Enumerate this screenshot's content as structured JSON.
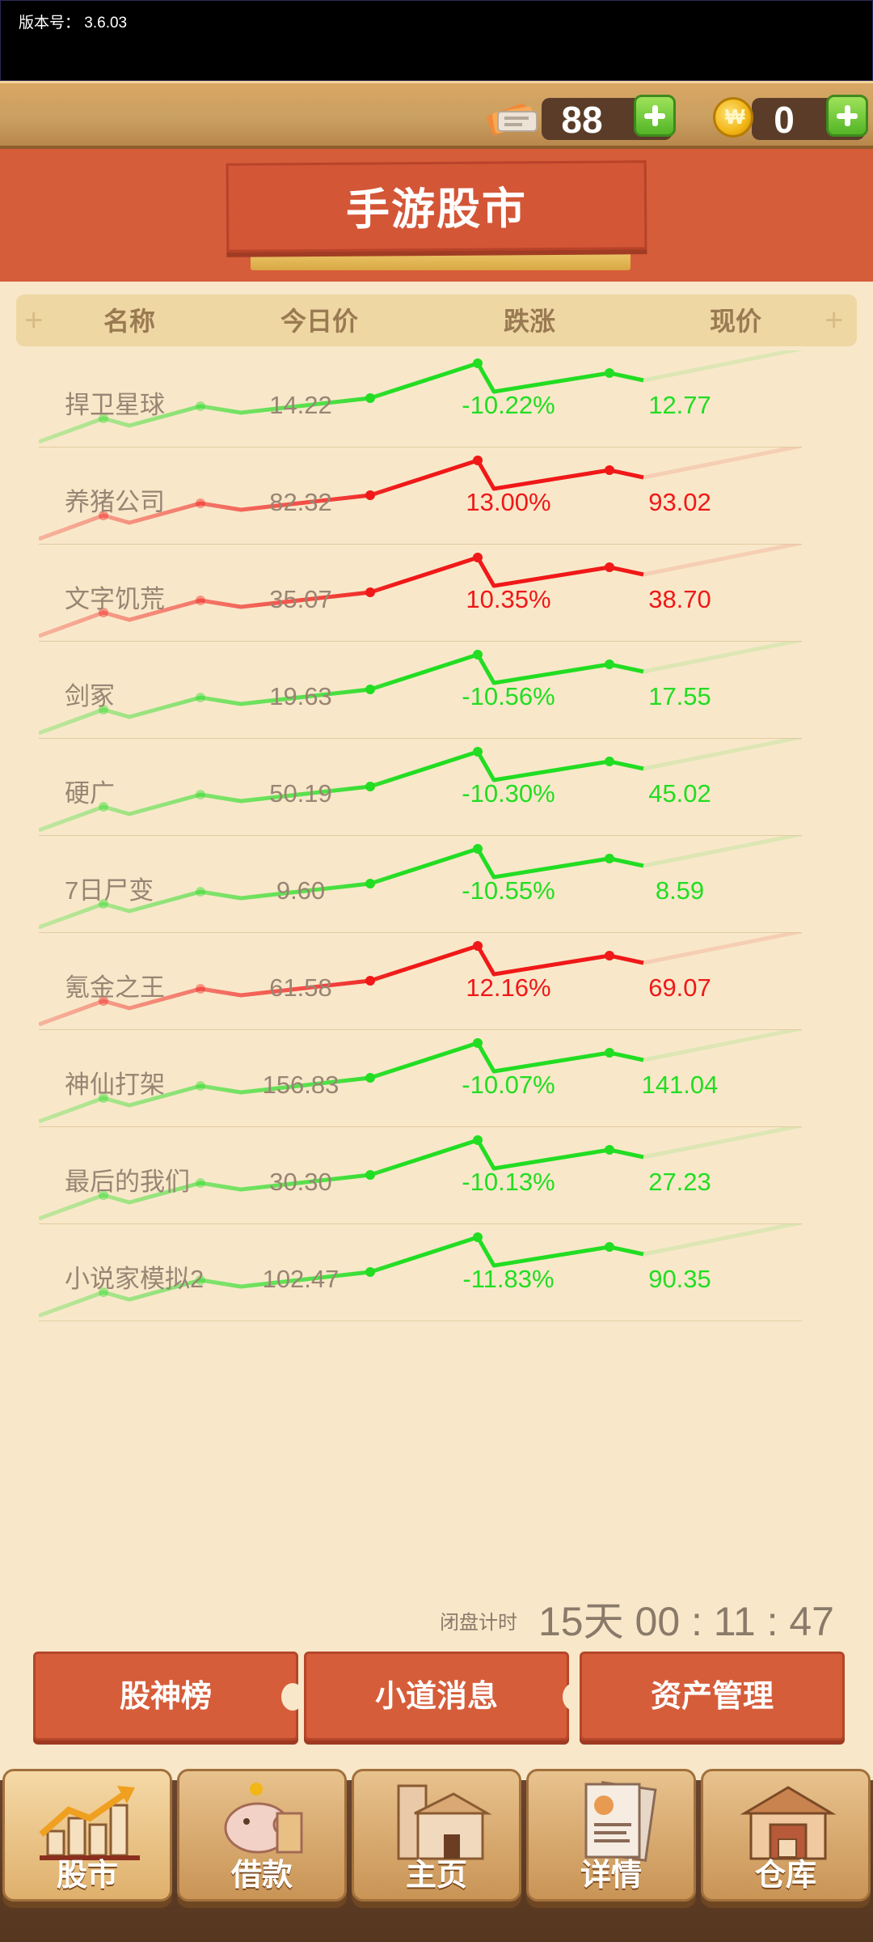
{
  "version_text": "版本号：  3.6.03",
  "resources": {
    "tickets": "88",
    "coins": "0",
    "coin_symbol": "₩"
  },
  "title": "手游股市",
  "columns": {
    "name": "名称",
    "today": "今日价",
    "change": "跌涨",
    "current": "现价"
  },
  "stocks": [
    {
      "name": "捍卫星球",
      "today": "14.22",
      "change": "-10.22%",
      "current": "12.77",
      "trend": "down"
    },
    {
      "name": "养猪公司",
      "today": "82.32",
      "change": "13.00%",
      "current": "93.02",
      "trend": "up"
    },
    {
      "name": "文字饥荒",
      "today": "35.07",
      "change": "10.35%",
      "current": "38.70",
      "trend": "up"
    },
    {
      "name": "剑冢",
      "today": "19.63",
      "change": "-10.56%",
      "current": "17.55",
      "trend": "down"
    },
    {
      "name": "硬广",
      "today": "50.19",
      "change": "-10.30%",
      "current": "45.02",
      "trend": "down"
    },
    {
      "name": "7日尸变",
      "today": "9.60",
      "change": "-10.55%",
      "current": "8.59",
      "trend": "down"
    },
    {
      "name": "氪金之王",
      "today": "61.58",
      "change": "12.16%",
      "current": "69.07",
      "trend": "up"
    },
    {
      "name": "神仙打架",
      "today": "156.83",
      "change": "-10.07%",
      "current": "141.04",
      "trend": "down"
    },
    {
      "name": "最后的我们",
      "today": "30.30",
      "change": "-10.13%",
      "current": "27.23",
      "trend": "down"
    },
    {
      "name": "小说家模拟2",
      "today": "102.47",
      "change": "-11.83%",
      "current": "90.35",
      "trend": "down"
    }
  ],
  "colors": {
    "up": "#f01818",
    "down": "#22dd22",
    "accent": "#d65d3a"
  },
  "timer": {
    "label": "闭盘计时",
    "value": "15天 00 : 11 : 47"
  },
  "actions": [
    "股神榜",
    "小道消息",
    "资产管理"
  ],
  "nav": [
    {
      "label": "股市",
      "icon": "chart-icon"
    },
    {
      "label": "借款",
      "icon": "piggy-bank-icon"
    },
    {
      "label": "主页",
      "icon": "house-icon"
    },
    {
      "label": "详情",
      "icon": "document-icon"
    },
    {
      "label": "仓库",
      "icon": "warehouse-icon"
    }
  ]
}
